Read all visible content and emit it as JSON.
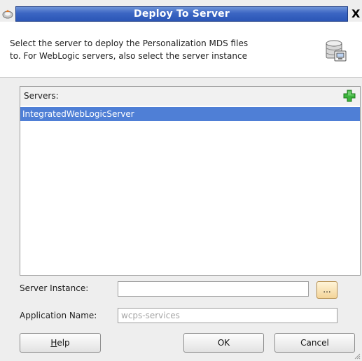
{
  "window": {
    "title": "Deploy To Server",
    "close_glyph": "X"
  },
  "header": {
    "description_line1": "Select the server to deploy the Personalization MDS files",
    "description_line2": "to. For WebLogic servers, also select the server instance",
    "icon": "database-server-icon"
  },
  "servers": {
    "label": "Servers:",
    "add_icon": "green-plus-icon",
    "items": [
      {
        "name": "IntegratedWebLogicServer",
        "selected": true
      }
    ]
  },
  "form": {
    "server_instance_label": "Server Instance:",
    "server_instance_value": "",
    "browse_label": "...",
    "application_name_label": "Application Name:",
    "application_name_value": "wcps-services"
  },
  "buttons": {
    "help_mnemonic": "H",
    "help_rest": "elp",
    "ok": "OK",
    "cancel": "Cancel"
  },
  "colors": {
    "titlebar": "#3b65c3",
    "selection": "#4f7fd6",
    "add_icon": "#2fa62f"
  }
}
